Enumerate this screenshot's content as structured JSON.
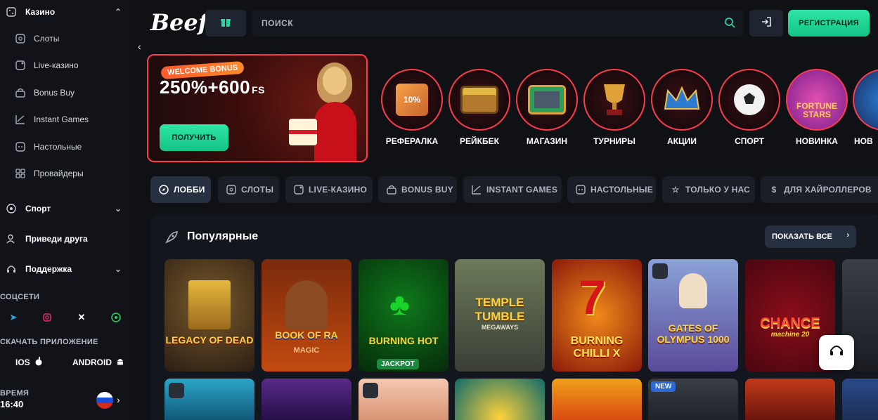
{
  "header": {
    "logo": "Beef",
    "search_placeholder": "ПОИСК",
    "register_label": "РЕГИСТРАЦИЯ"
  },
  "sidebar": {
    "casino": "Казино",
    "items": [
      {
        "label": "Слоты"
      },
      {
        "label": "Live-казино"
      },
      {
        "label": "Bonus Buy"
      },
      {
        "label": "Instant Games"
      },
      {
        "label": "Настольные"
      },
      {
        "label": "Провайдеры"
      }
    ],
    "sport": "Спорт",
    "refer": "Приведи друга",
    "support": "Поддержка",
    "socials_label": "СОЦСЕТИ",
    "app_label": "СКАЧАТЬ ПРИЛОЖЕНИЕ",
    "ios": "IOS",
    "android": "ANDROID",
    "time_label": "ВРЕМЯ",
    "time": "16:40"
  },
  "banner": {
    "welcome": "WELCOME BONUS",
    "bonus_main": "250%+600",
    "bonus_fs": "FS",
    "get_label": "ПОЛУЧИТЬ"
  },
  "promos": [
    {
      "label": "РЕФЕРАЛКА",
      "icon": "10%"
    },
    {
      "label": "РЕЙКБЕК",
      "icon": "chest"
    },
    {
      "label": "МАГАЗИН",
      "icon": "box"
    },
    {
      "label": "ТУРНИРЫ",
      "icon": "trophy"
    },
    {
      "label": "АКЦИИ",
      "icon": "crown"
    },
    {
      "label": "СПОРТ",
      "icon": "ball"
    },
    {
      "label": "НОВИНКА",
      "icon": "fortune-stars"
    },
    {
      "label": "НОВ",
      "icon": "cut"
    }
  ],
  "tabs": [
    {
      "label": "ЛОББИ"
    },
    {
      "label": "СЛОТЫ"
    },
    {
      "label": "LIVE-КАЗИНО"
    },
    {
      "label": "BONUS BUY"
    },
    {
      "label": "INSTANT GAMES"
    },
    {
      "label": "НАСТОЛЬНЫЕ"
    },
    {
      "label": "ТОЛЬКО У НАС"
    },
    {
      "label": "ДЛЯ ХАЙРОЛЛЕРОВ"
    }
  ],
  "popular": {
    "title": "Популярные",
    "show_all": "ПОКАЗАТЬ ВСЕ"
  },
  "games_row1": [
    {
      "title": "LEGACY OF DEAD"
    },
    {
      "title": "BOOK OF RA"
    },
    {
      "title": "BURNING HOT"
    },
    {
      "title": "TEMPLE TUMBLE"
    },
    {
      "title": "BURNING CHILLI X"
    },
    {
      "title": "GATES OF OLYMPUS 1000"
    },
    {
      "title": "CHANCE"
    }
  ],
  "row1_sub": {
    "bookofra_sub": "MAGIC",
    "burninghot_badge": "JACKPOT",
    "temple_sub": "MEGAWAYS",
    "chance_sub": "machine 20"
  },
  "new_badge": "NEW",
  "colors": {
    "accent": "#1fd196",
    "brand_red": "#ff3a4d"
  }
}
